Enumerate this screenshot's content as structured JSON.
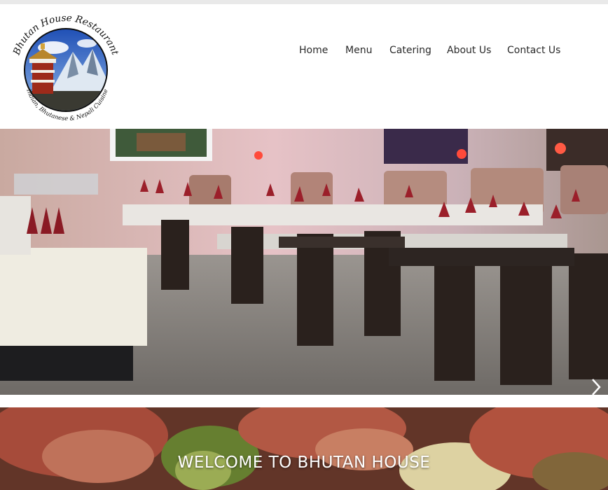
{
  "logo": {
    "name": "Bhutan House Restaurant",
    "tagline": "Indian, Bhutanese & Nepali Cuisine"
  },
  "nav": {
    "items": [
      {
        "label": "Home"
      },
      {
        "label": "Menu"
      },
      {
        "label": "Catering"
      },
      {
        "label": "About Us"
      },
      {
        "label": "Contact Us"
      }
    ]
  },
  "hero": {
    "icon": "chevron-right-icon"
  },
  "welcome": {
    "title": "WELCOME TO BHUTAN HOUSE"
  },
  "colors": {
    "nav_text": "#2a2a2a",
    "welcome_text": "#ffffff",
    "logo_ring": "#0a0a0a"
  }
}
